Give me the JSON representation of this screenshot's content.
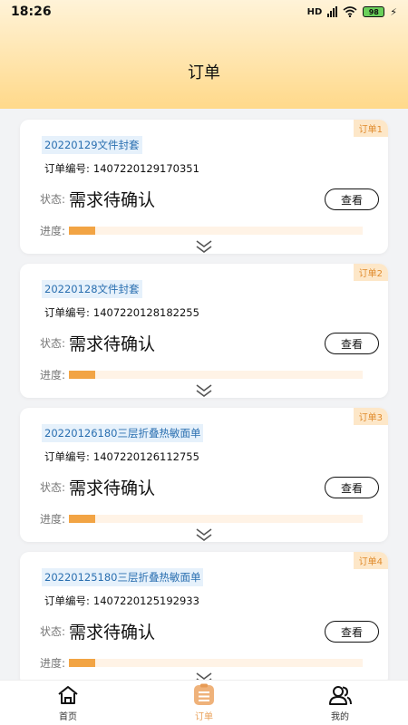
{
  "status_bar": {
    "time": "18:26",
    "battery": "98",
    "network": "HD"
  },
  "header": {
    "title": "订单"
  },
  "orders": [
    {
      "tag": "订单1",
      "title": "20220129文件封套",
      "no_label": "订单编号:",
      "no": "1407220129170351",
      "status_label": "状态:",
      "status": "需求待确认",
      "button": "查看",
      "progress_label": "进度:",
      "progress": 0.09
    },
    {
      "tag": "订单2",
      "title": "20220128文件封套",
      "no_label": "订单编号:",
      "no": "1407220128182255",
      "status_label": "状态:",
      "status": "需求待确认",
      "button": "查看",
      "progress_label": "进度:",
      "progress": 0.09
    },
    {
      "tag": "订单3",
      "title": "20220126180三层折叠热敏面单",
      "no_label": "订单编号:",
      "no": "1407220126112755",
      "status_label": "状态:",
      "status": "需求待确认",
      "button": "查看",
      "progress_label": "进度:",
      "progress": 0.09
    },
    {
      "tag": "订单4",
      "title": "20220125180三层折叠热敏面单",
      "no_label": "订单编号:",
      "no": "1407220125192933",
      "status_label": "状态:",
      "status": "需求待确认",
      "button": "查看",
      "progress_label": "进度:",
      "progress": 0.09
    }
  ],
  "tabs": [
    {
      "label": "首页",
      "icon": "home-icon"
    },
    {
      "label": "订单",
      "icon": "orders-icon"
    },
    {
      "label": "我的",
      "icon": "profile-icon"
    }
  ],
  "colors": {
    "accent": "#e9a15a",
    "progress": "#f2a444",
    "tag_bg": "#fde7c8",
    "title_bg": "#e6f1fb",
    "title_text": "#2a6fb0"
  }
}
